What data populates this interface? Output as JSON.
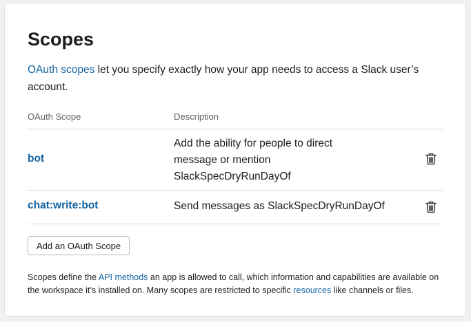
{
  "header": {
    "title": "Scopes"
  },
  "intro": {
    "link_text": "OAuth scopes",
    "text": " let you specify exactly how your app needs to access a Slack user’s account."
  },
  "table": {
    "headers": [
      "OAuth Scope",
      "Description"
    ],
    "rows": [
      {
        "scope": "bot",
        "description": "Add the ability for people to direct message or mention SlackSpecDryRunDayOf",
        "action_icon": "trash-icon"
      },
      {
        "scope": "chat:write:bot",
        "description": "Send messages as SlackSpecDryRunDayOf",
        "action_icon": "trash-icon"
      }
    ]
  },
  "actions": {
    "add_scope_label": "Add an OAuth Scope"
  },
  "footer": {
    "part1": "Scopes define the ",
    "link1": "API methods",
    "part2": " an app is allowed to call, which information and capabilities are available on the workspace it’s installed on. Many scopes are restricted to specific ",
    "link2": "resources",
    "part3": " like channels or files."
  },
  "colors": {
    "link": "#1264a3",
    "text": "#1d1c1d",
    "muted": "#616061",
    "border": "#dddddd",
    "background": "#f1f1f1"
  }
}
